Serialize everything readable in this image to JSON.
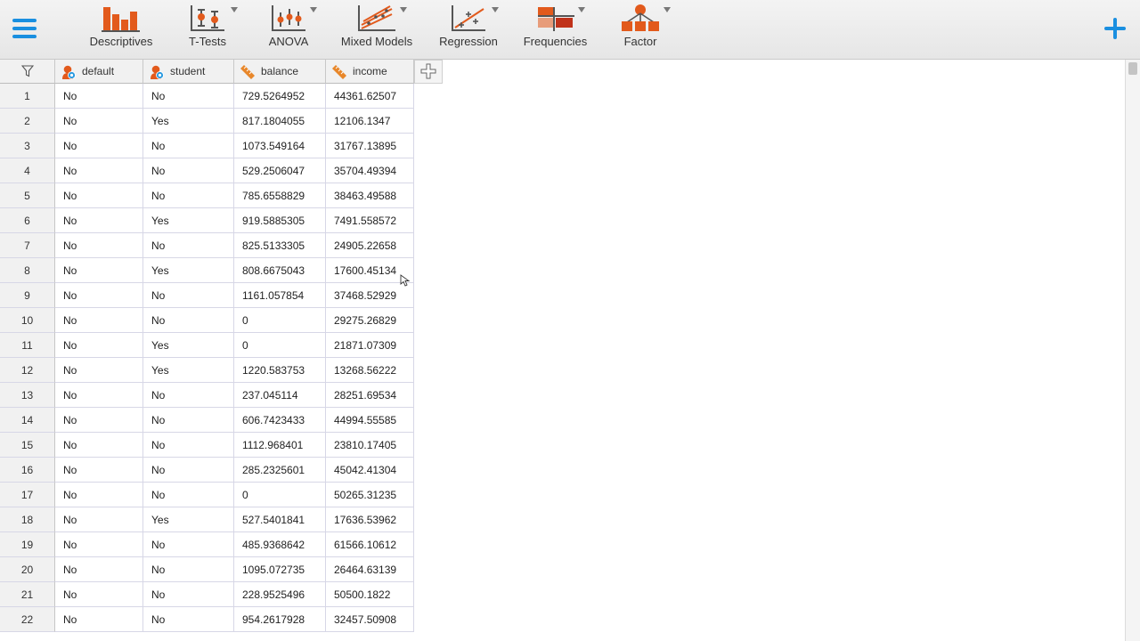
{
  "toolbar": {
    "accent_color": "#1a8fe0",
    "analyses": [
      {
        "label": "Descriptives",
        "icon": "bar-chart-icon"
      },
      {
        "label": "T-Tests",
        "icon": "t-test-icon"
      },
      {
        "label": "ANOVA",
        "icon": "anova-icon"
      },
      {
        "label": "Mixed Models",
        "icon": "mixed-models-icon"
      },
      {
        "label": "Regression",
        "icon": "regression-icon"
      },
      {
        "label": "Frequencies",
        "icon": "frequencies-icon"
      },
      {
        "label": "Factor",
        "icon": "factor-icon"
      }
    ]
  },
  "spreadsheet": {
    "columns": [
      {
        "name": "default",
        "type": "nominal"
      },
      {
        "name": "student",
        "type": "nominal"
      },
      {
        "name": "balance",
        "type": "continuous"
      },
      {
        "name": "income",
        "type": "continuous"
      }
    ],
    "rows": [
      [
        "1",
        "No",
        "No",
        "729.5264952",
        "44361.62507"
      ],
      [
        "2",
        "No",
        "Yes",
        "817.1804055",
        "12106.1347"
      ],
      [
        "3",
        "No",
        "No",
        "1073.549164",
        "31767.13895"
      ],
      [
        "4",
        "No",
        "No",
        "529.2506047",
        "35704.49394"
      ],
      [
        "5",
        "No",
        "No",
        "785.6558829",
        "38463.49588"
      ],
      [
        "6",
        "No",
        "Yes",
        "919.5885305",
        "7491.558572"
      ],
      [
        "7",
        "No",
        "No",
        "825.5133305",
        "24905.22658"
      ],
      [
        "8",
        "No",
        "Yes",
        "808.6675043",
        "17600.45134"
      ],
      [
        "9",
        "No",
        "No",
        "1161.057854",
        "37468.52929"
      ],
      [
        "10",
        "No",
        "No",
        "0",
        "29275.26829"
      ],
      [
        "11",
        "No",
        "Yes",
        "0",
        "21871.07309"
      ],
      [
        "12",
        "No",
        "Yes",
        "1220.583753",
        "13268.56222"
      ],
      [
        "13",
        "No",
        "No",
        "237.045114",
        "28251.69534"
      ],
      [
        "14",
        "No",
        "No",
        "606.7423433",
        "44994.55585"
      ],
      [
        "15",
        "No",
        "No",
        "1112.968401",
        "23810.17405"
      ],
      [
        "16",
        "No",
        "No",
        "285.2325601",
        "45042.41304"
      ],
      [
        "17",
        "No",
        "No",
        "0",
        "50265.31235"
      ],
      [
        "18",
        "No",
        "Yes",
        "527.5401841",
        "17636.53962"
      ],
      [
        "19",
        "No",
        "No",
        "485.9368642",
        "61566.10612"
      ],
      [
        "20",
        "No",
        "No",
        "1095.072735",
        "26464.63139"
      ],
      [
        "21",
        "No",
        "No",
        "228.9525496",
        "50500.1822"
      ],
      [
        "22",
        "No",
        "No",
        "954.2617928",
        "32457.50908"
      ]
    ]
  }
}
